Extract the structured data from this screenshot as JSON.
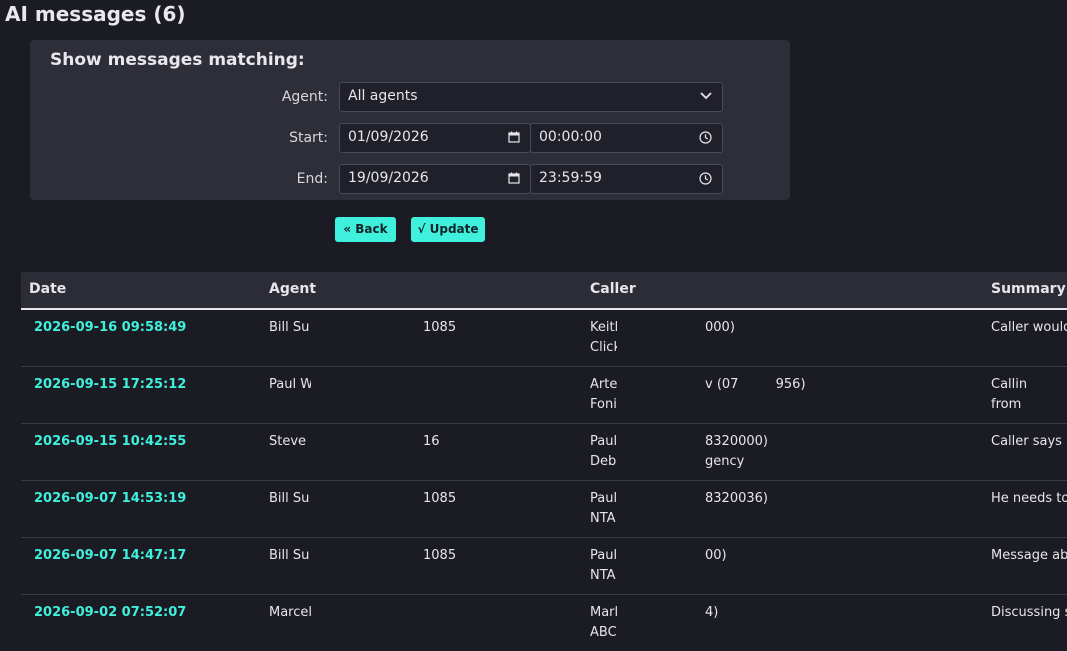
{
  "page_title": "AI messages (6)",
  "filter": {
    "heading": "Show messages matching:",
    "agent_label": "Agent:",
    "agent_value": "All agents",
    "start_label": "Start:",
    "start_date": "01/09/2026",
    "start_time": "00:00:00",
    "end_label": "End:",
    "end_date": "19/09/2026",
    "end_time": "23:59:59"
  },
  "buttons": {
    "back": "« Back",
    "update": "√ Update"
  },
  "table": {
    "headers": {
      "date": "Date",
      "agent": "Agent",
      "caller": "Caller",
      "summary": "Summary"
    },
    "rows": [
      {
        "date": "2026-09-16 09:58:49",
        "agent": "Bill Su",
        "ext": "1085",
        "caller1": "Keith",
        "caller2": "Click",
        "num1": "000)",
        "num2": "",
        "sum1": "Caller would",
        "sum2": ""
      },
      {
        "date": "2026-09-15 17:25:12",
        "agent": "Paul W",
        "ext": "",
        "caller1": "Arte",
        "caller2": "Foni",
        "num1": "v (07         956)",
        "num2": "",
        "sum1": "Callin",
        "sum2": "from"
      },
      {
        "date": "2026-09-15 10:42:55",
        "agent": "Steve",
        "ext": "16",
        "caller1": "Paul",
        "caller2": "Deb",
        "num1": "8320000)",
        "num2": "gency",
        "sum1": "Caller says",
        "sum2": ""
      },
      {
        "date": "2026-09-07 14:53:19",
        "agent": "Bill Su",
        "ext": "1085",
        "caller1": "Paul",
        "caller2": "NTA",
        "num1": "8320036)",
        "num2": "",
        "sum1": "He needs to",
        "sum2": ""
      },
      {
        "date": "2026-09-07 14:47:17",
        "agent": "Bill Su",
        "ext": "1085",
        "caller1": "Paul",
        "caller2": "NTA",
        "num1": "00)",
        "num2": "",
        "sum1": "Message ab",
        "sum2": ""
      },
      {
        "date": "2026-09-02 07:52:07",
        "agent": "Marcel",
        "ext": "",
        "caller1": "Marl",
        "caller2": "ABC",
        "num1": "4)",
        "num2": "",
        "sum1": "Discussing s",
        "sum2": ""
      }
    ]
  },
  "colors": {
    "accent": "#3ff0dc",
    "background": "#1b1b23",
    "panel": "#2e2e38"
  },
  "icons": {
    "dropdown": "chevron-down-icon",
    "date": "calendar-icon",
    "time": "clock-icon"
  }
}
